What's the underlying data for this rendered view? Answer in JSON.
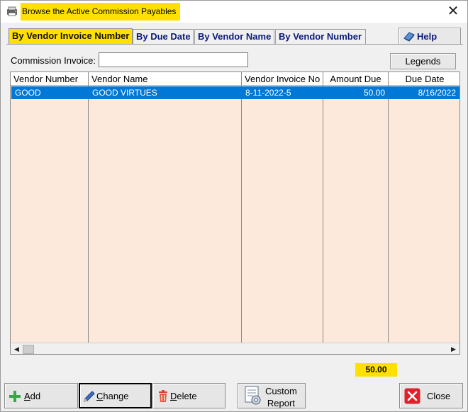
{
  "window": {
    "title": "Browse the Active Commission Payables",
    "close_glyph": "✕"
  },
  "tabs": [
    {
      "label": "By Vendor Invoice Number",
      "active": true
    },
    {
      "label": "By Due Date",
      "active": false
    },
    {
      "label": "By Vendor Name",
      "active": false
    },
    {
      "label": "By Vendor Number",
      "active": false
    }
  ],
  "help_button": {
    "label": "Help",
    "icon": "book-icon"
  },
  "commission_invoice": {
    "label": "Commission Invoice:",
    "value": "",
    "placeholder": ""
  },
  "legends_button": {
    "label": "Legends"
  },
  "grid": {
    "columns": [
      "Vendor Number",
      "Vendor Name",
      "Vendor Invoice No",
      "Amount Due",
      "Due Date"
    ],
    "rows": [
      {
        "vendor_number": "GOOD",
        "vendor_name": "GOOD VIRTUES",
        "vendor_invoice_no": "8-11-2022-5",
        "amount_due": "50.00",
        "due_date": "8/16/2022",
        "selected": true
      }
    ],
    "scroll_left_glyph": "◀",
    "scroll_right_glyph": "▶"
  },
  "total_amount": "50.00",
  "actions": {
    "add": {
      "label_u": "A",
      "label_rest": "dd",
      "icon": "plus-icon"
    },
    "change": {
      "label_u": "C",
      "label_rest": "hange",
      "icon": "pencil-icon"
    },
    "delete": {
      "label_u": "D",
      "label_rest": "elete",
      "icon": "trash-icon"
    },
    "custom_report": {
      "line1": "Custom",
      "line2": "Report",
      "icon": "report-icon"
    },
    "close": {
      "label": "Close",
      "icon": "close-icon"
    }
  },
  "colors": {
    "highlight": "#ffe000",
    "selection": "#0078d7",
    "grid_bg": "#fde8dc",
    "tab_text": "#0a1a7a"
  }
}
